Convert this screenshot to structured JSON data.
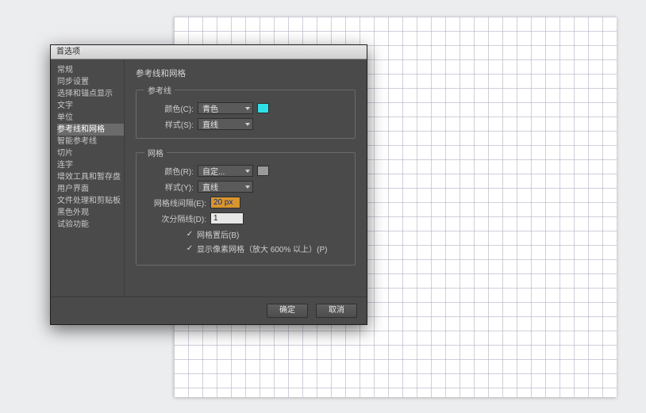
{
  "dialog": {
    "title": "首选项",
    "panel_title": "参考线和网格",
    "sidebar": [
      "常规",
      "同步设置",
      "选择和锚点显示",
      "文字",
      "单位",
      "参考线和网格",
      "智能参考线",
      "切片",
      "连字",
      "增效工具和暂存盘",
      "用户界面",
      "文件处理和剪贴板",
      "黑色外观",
      "试验功能"
    ],
    "selected_index": 5,
    "guides": {
      "legend": "参考线",
      "color_label": "颜色(C):",
      "color_value": "青色",
      "color_swatch": "#2fe0e6",
      "style_label": "样式(S):",
      "style_value": "直线"
    },
    "grid": {
      "legend": "网格",
      "color_label": "颜色(R):",
      "color_value": "自定...",
      "color_swatch": "#9a9a9a",
      "style_label": "样式(Y):",
      "style_value": "直线",
      "spacing_label": "网格线间隔(E):",
      "spacing_value": "20 px",
      "subdiv_label": "次分隔线(D):",
      "subdiv_value": "1",
      "check_back": "网格置后(B)",
      "check_pixel": "显示像素网格（放大 600% 以上）(P)"
    },
    "buttons": {
      "ok": "确定",
      "cancel": "取消"
    }
  }
}
